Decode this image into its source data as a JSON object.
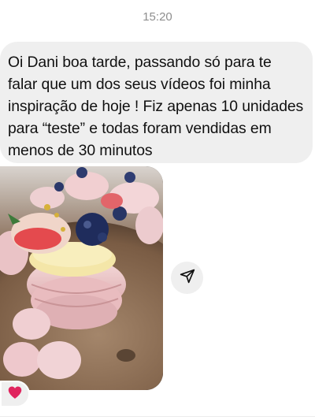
{
  "status": {
    "time": "15:20"
  },
  "message": {
    "text": "Oi Dani boa tarde, passando só para te falar que um dos seus vídeos foi minha inspiração de hoje ! Fiz apenas 10 unidades para “teste” e todas foram vendidas em menos de 30 minutos"
  },
  "attachment": {
    "kind": "photo"
  },
  "actions": {
    "share_icon": "paper-plane-icon"
  },
  "reaction": {
    "emoji": "heart",
    "color": "#e0245e"
  },
  "colors": {
    "bubble": "#efefef",
    "text": "#111111",
    "timestamp": "#8e8e8e"
  }
}
